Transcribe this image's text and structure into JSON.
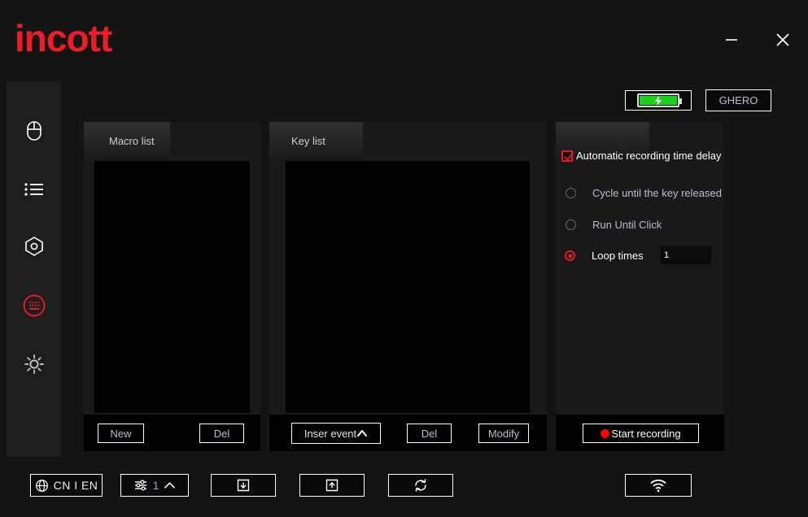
{
  "window": {
    "logo_text": "incott",
    "minimize_label": "minimize",
    "close_label": "close"
  },
  "sidebar": {
    "items": [
      {
        "icon": "mouse-icon",
        "label": "Mouse",
        "active": false
      },
      {
        "icon": "list-icon",
        "label": "List",
        "active": false
      },
      {
        "icon": "hexagon-settings-icon",
        "label": "Settings",
        "active": false
      },
      {
        "icon": "macro-keyboard-icon",
        "label": "Macro",
        "active": true
      },
      {
        "icon": "brightness-icon",
        "label": "Light",
        "active": false
      }
    ]
  },
  "status": {
    "battery_icon": "battery-charging-icon",
    "device_name": "GHERO"
  },
  "macro_panel": {
    "title": "Macro list",
    "items": [],
    "new_label": "New",
    "del_label": "Del"
  },
  "key_panel": {
    "title": "Key list",
    "items": [],
    "insert_label": "Inser event",
    "insert_chevron_icon": "chevron-up-icon",
    "del_label": "Del",
    "modify_label": "Modify"
  },
  "options_panel": {
    "auto_delay": {
      "label": "Automatic recording time delay",
      "checked": true
    },
    "modes": [
      {
        "label": "Cycle until the key released",
        "selected": false
      },
      {
        "label": "Run Until Click",
        "selected": false
      },
      {
        "label": "Loop times",
        "selected": true
      }
    ],
    "loop_times_value": "1",
    "loop_times_placeholder": "1",
    "record_button": {
      "label": "Start recording",
      "icon": "record-dot-icon"
    }
  },
  "bottom_bar": {
    "language": {
      "icon": "globe-icon",
      "label": "CN I EN"
    },
    "profile": {
      "icon": "sliders-icon",
      "value": "1",
      "chevron_icon": "chevron-up-icon"
    },
    "import": {
      "icon": "file-download-icon",
      "label": ""
    },
    "export": {
      "icon": "file-upload-icon",
      "label": ""
    },
    "sync": {
      "icon": "refresh-icon",
      "label": ""
    },
    "wifi": {
      "icon": "wifi-icon",
      "label": ""
    }
  },
  "colors": {
    "brand_red": "#ef1b25",
    "accent_red": "#e21b22",
    "battery_green": "#19d219",
    "background": "#141414",
    "panel": "#191919",
    "list_bg": "#000000",
    "text": "#b9bfd0"
  }
}
